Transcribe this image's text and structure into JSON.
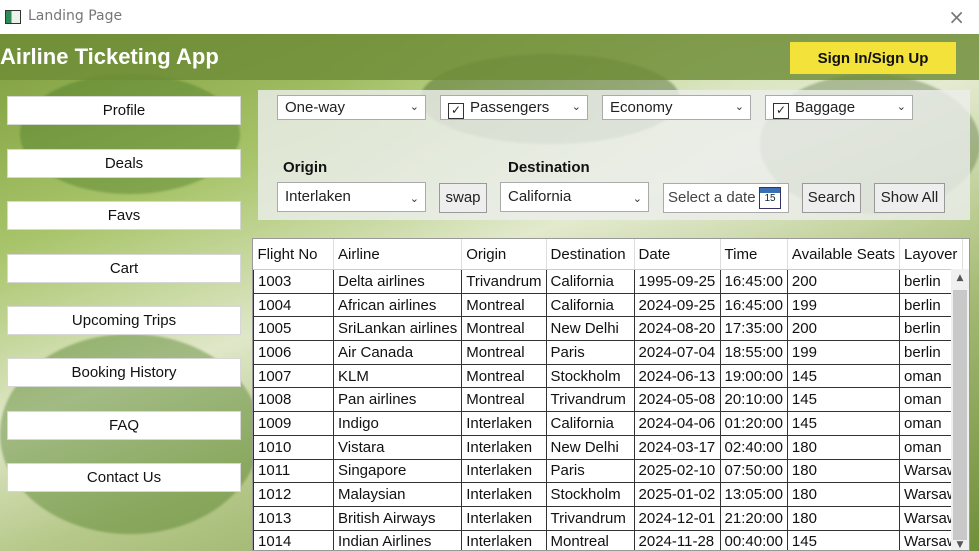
{
  "window": {
    "title": "Landing Page",
    "close_icon": "×"
  },
  "header": {
    "app_title": "Airline Ticketing App",
    "signin_label": "Sign In/Sign Up"
  },
  "sidebar": {
    "items": [
      {
        "label": "Profile"
      },
      {
        "label": "Deals"
      },
      {
        "label": "Favs"
      },
      {
        "label": "Cart"
      },
      {
        "label": "Upcoming Trips"
      },
      {
        "label": "Booking History"
      },
      {
        "label": "FAQ"
      },
      {
        "label": "Contact Us"
      }
    ]
  },
  "filters": {
    "trip_type": "One-way",
    "passengers": {
      "label": "Passengers",
      "checked": true
    },
    "class": "Economy",
    "baggage": {
      "label": "Baggage",
      "checked": true
    },
    "origin_label": "Origin",
    "origin_value": "Interlaken",
    "swap_label": "swap",
    "destination_label": "Destination",
    "destination_value": "California",
    "date_placeholder": "Select a date",
    "calendar_day": "15",
    "search_label": "Search",
    "show_all_label": "Show All"
  },
  "flights": {
    "columns": [
      "Flight No",
      "Airline",
      "Origin",
      "Destination",
      "Date",
      "Time",
      "Available Seats",
      "Layover"
    ],
    "rows": [
      [
        "1003",
        "Delta airlines",
        "Trivandrum",
        "California",
        "1995-09-25",
        "16:45:00",
        "200",
        "berlin"
      ],
      [
        "1004",
        "African airlines",
        "Montreal",
        "California",
        "2024-09-25",
        "16:45:00",
        "199",
        "berlin"
      ],
      [
        "1005",
        "SriLankan airlines",
        "Montreal",
        "New Delhi",
        "2024-08-20",
        "17:35:00",
        "200",
        "berlin"
      ],
      [
        "1006",
        "Air Canada",
        "Montreal",
        "Paris",
        "2024-07-04",
        "18:55:00",
        "199",
        "berlin"
      ],
      [
        "1007",
        "KLM",
        "Montreal",
        "Stockholm",
        "2024-06-13",
        "19:00:00",
        "145",
        "oman"
      ],
      [
        "1008",
        "Pan airlines",
        "Montreal",
        "Trivandrum",
        "2024-05-08",
        "20:10:00",
        "145",
        "oman"
      ],
      [
        "1009",
        "Indigo",
        "Interlaken",
        "California",
        "2024-04-06",
        "01:20:00",
        "145",
        "oman"
      ],
      [
        "1010",
        "Vistara",
        "Interlaken",
        "New Delhi",
        "2024-03-17",
        "02:40:00",
        "180",
        "oman"
      ],
      [
        "1011",
        "Singapore",
        "Interlaken",
        "Paris",
        "2025-02-10",
        "07:50:00",
        "180",
        "Warsaw"
      ],
      [
        "1012",
        "Malaysian",
        "Interlaken",
        "Stockholm",
        "2025-01-02",
        "13:05:00",
        "180",
        "Warsaw"
      ],
      [
        "1013",
        "British Airways",
        "Interlaken",
        "Trivandrum",
        "2024-12-01",
        "21:20:00",
        "180",
        "Warsaw"
      ],
      [
        "1014",
        "Indian Airlines",
        "Interlaken",
        "Montreal",
        "2024-11-28",
        "00:40:00",
        "145",
        "Warsaw"
      ]
    ]
  },
  "colors": {
    "header": "#6e8c37",
    "signin_button": "#f2e23a"
  }
}
